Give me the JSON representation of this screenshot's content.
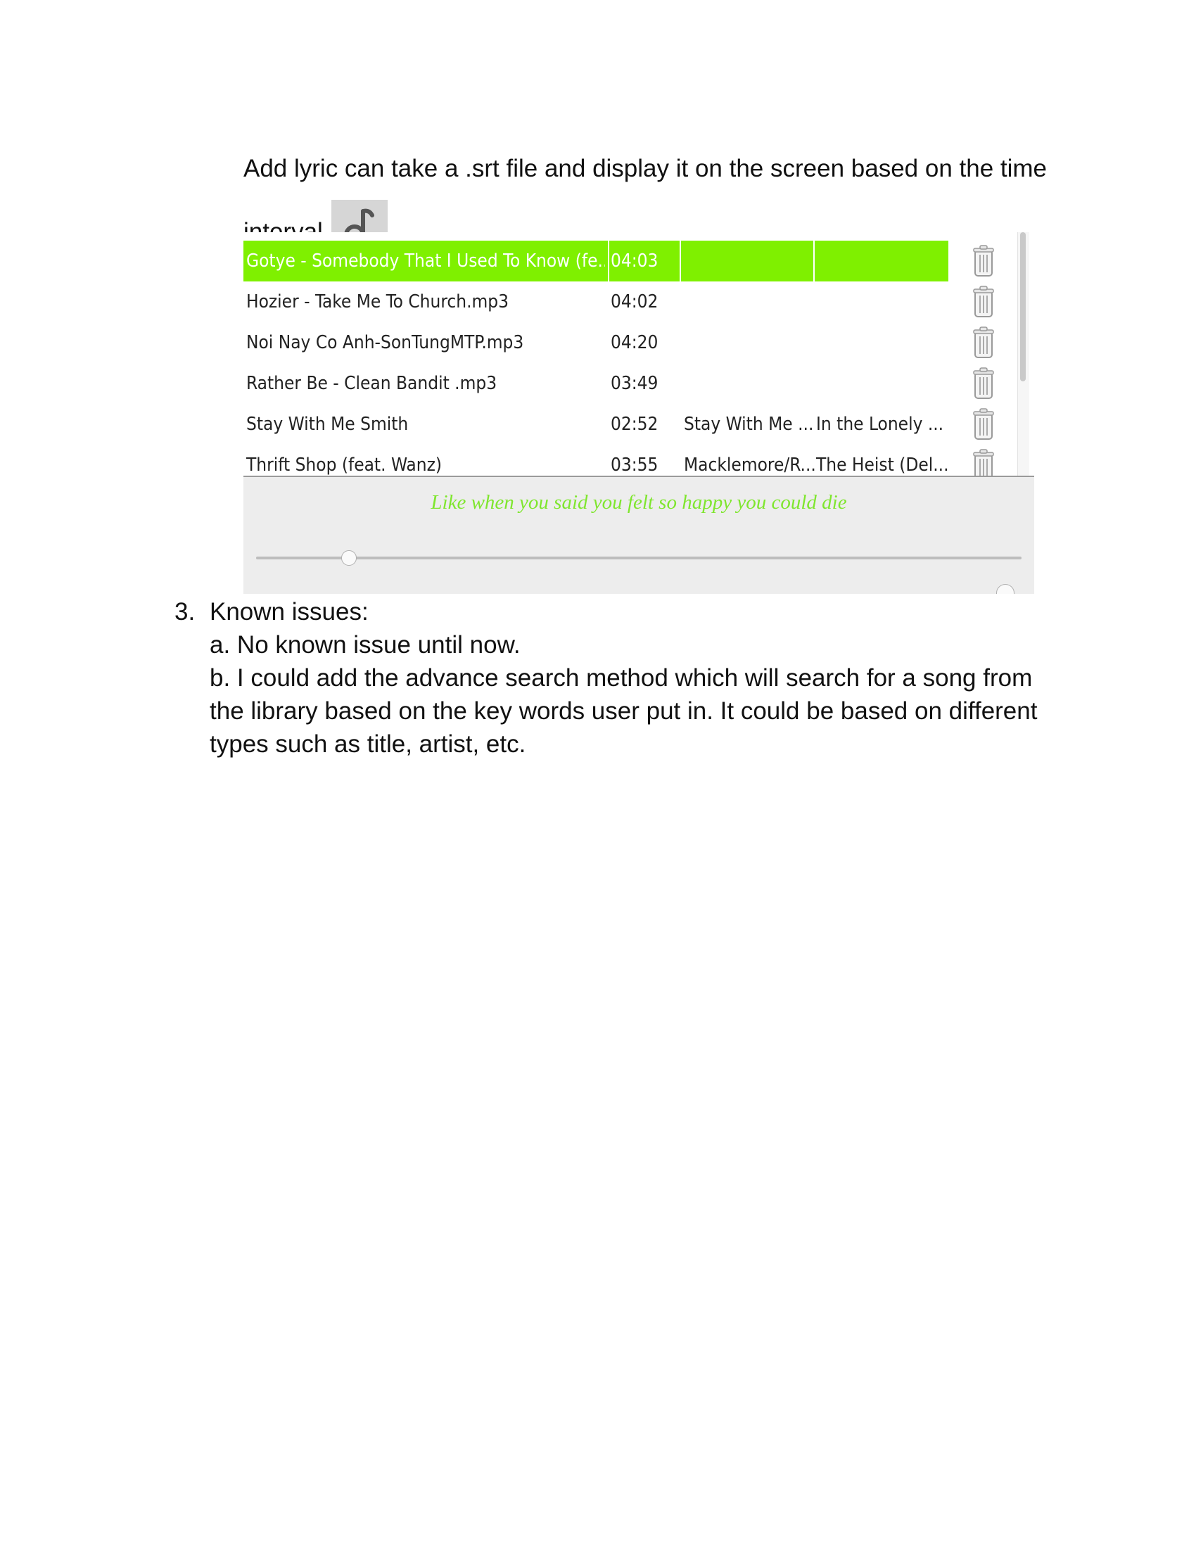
{
  "intro": {
    "text": "Add lyric can take a .srt file and display it on the screen based on the time interval.",
    "lyric_icon": "music-note-icon"
  },
  "player": {
    "tracks": [
      {
        "title": "Gotye - Somebody That I Used To Know (fe...",
        "duration": "04:03",
        "artist": "",
        "album": "",
        "selected": true
      },
      {
        "title": "Hozier - Take Me To Church.mp3",
        "duration": "04:02",
        "artist": "",
        "album": ""
      },
      {
        "title": "Noi Nay Co Anh-SonTungMTP.mp3",
        "duration": "04:20",
        "artist": "",
        "album": ""
      },
      {
        "title": "Rather Be - Clean Bandit .mp3",
        "duration": "03:49",
        "artist": "",
        "album": ""
      },
      {
        "title": "Stay With Me Smith",
        "duration": "02:52",
        "artist": "Stay With Me ...",
        "album": "In the Lonely ..."
      },
      {
        "title": "Thrift Shop (feat. Wanz)",
        "duration": "03:55",
        "artist": "Macklemore/R...",
        "album": "The Heist (Del..."
      }
    ],
    "delete_icon": "trash-icon",
    "lyric_line": "Like when you said you felt so happy you could die",
    "selected_color": "#7ff000",
    "lyric_color": "#7fe62e",
    "progress_fraction": 0.12
  },
  "known_issues": {
    "number": "3.",
    "heading": "Known issues:",
    "items": [
      "a. No known issue until now.",
      "b. I could add the advance search method which will search for a song from the library based on the key words user put in. It could be based on different types such as title, artist, etc."
    ]
  }
}
